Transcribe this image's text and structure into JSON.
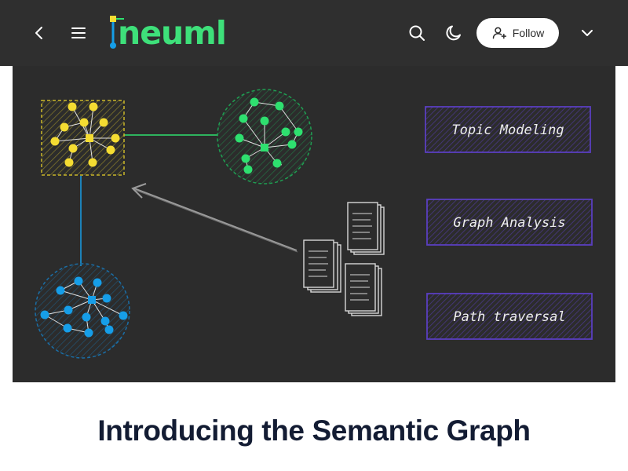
{
  "header": {
    "logo_text": "neuml",
    "follow_label": "Follow",
    "icons": [
      "back-chevron-icon",
      "menu-icon",
      "search-icon",
      "moon-icon",
      "add-user-icon",
      "chevron-down-icon"
    ],
    "background_color": "#2f2f2f",
    "brand_color": "#3ee07a"
  },
  "hero": {
    "boxes": [
      {
        "label": "Topic Modeling"
      },
      {
        "label": "Graph Analysis"
      },
      {
        "label": "Path traversal"
      }
    ],
    "cluster_colors": {
      "yellow": "#f4dc32",
      "green": "#2ee06f",
      "blue": "#169ee8"
    },
    "box_color": "#5a3fc0"
  },
  "article": {
    "title": "Introducing the Semantic Graph"
  }
}
